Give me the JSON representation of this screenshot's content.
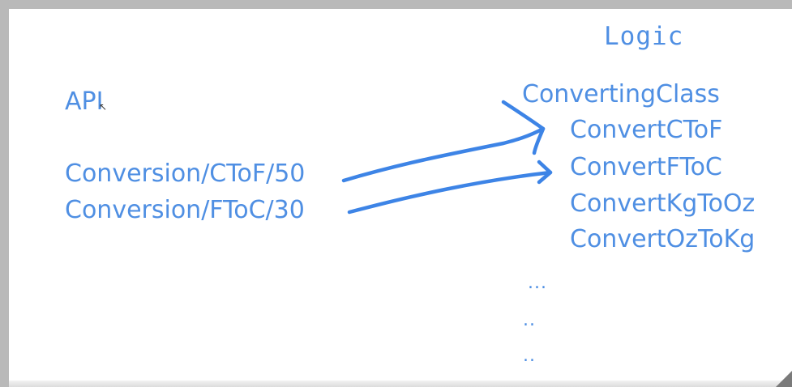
{
  "left": {
    "api_label": "API",
    "routes": [
      "Conversion/CToF/50",
      "Conversion/FToC/30"
    ]
  },
  "right": {
    "title": "Logic",
    "class_name": "ConvertingClass",
    "methods": [
      "ConvertCToF",
      "ConvertFToC",
      "ConvertKgToOz",
      "ConvertOzToKg"
    ],
    "continuation": [
      "...",
      "..",
      ".."
    ]
  },
  "colors": {
    "ink": "#4f8fe3",
    "arrow": "#3d84e6",
    "background": "#ffffff",
    "frame": "#b9b9b9"
  },
  "icons": [
    "mouse-pointer-icon",
    "resize-corner-icon"
  ]
}
